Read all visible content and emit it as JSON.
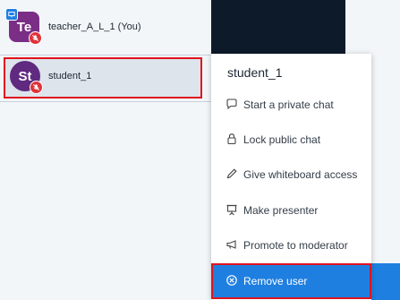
{
  "participants": [
    {
      "initials": "Te",
      "name": "teacher_A_L_1 (You)"
    },
    {
      "initials": "St",
      "name": "student_1"
    }
  ],
  "context_menu": {
    "title": "student_1",
    "items": [
      {
        "label": "Start a private chat",
        "icon": "chat-bubble-icon"
      },
      {
        "label": "Lock public chat",
        "icon": "lock-icon"
      },
      {
        "label": "Give whiteboard access",
        "icon": "pencil-icon"
      },
      {
        "label": "Make presenter",
        "icon": "presentation-icon"
      },
      {
        "label": "Promote to moderator",
        "icon": "megaphone-icon"
      },
      {
        "label": "Remove user",
        "icon": "remove-circle-icon"
      }
    ]
  },
  "colors": {
    "accent": "#1f7fe0",
    "highlight": "#e0131f",
    "avatar_teacher": "#7b2e86",
    "avatar_student": "#5f2a80"
  }
}
